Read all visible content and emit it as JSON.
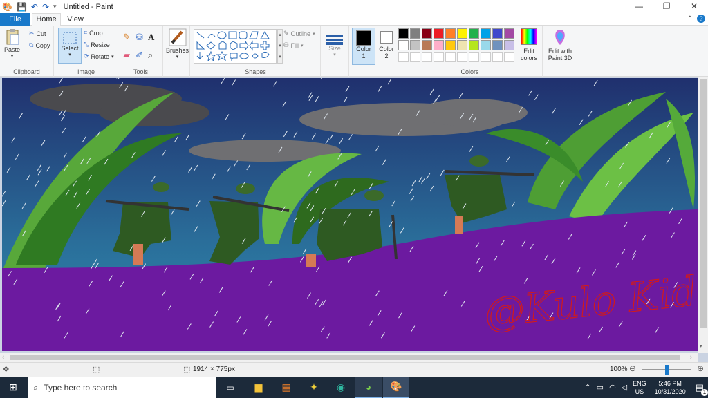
{
  "window": {
    "title": "Untitled - Paint",
    "minimize_glyph": "—",
    "maximize_glyph": "❐",
    "close_glyph": "✕"
  },
  "quick_access": {
    "save_icon": "save-icon",
    "undo_icon": "undo-icon",
    "redo_icon": "redo-icon"
  },
  "tabs": {
    "file": "File",
    "home": "Home",
    "view": "View"
  },
  "ribbon": {
    "clipboard": {
      "label": "Clipboard",
      "paste": "Paste",
      "cut": "Cut",
      "copy": "Copy"
    },
    "image": {
      "label": "Image",
      "select": "Select",
      "crop": "Crop",
      "resize": "Resize",
      "rotate": "Rotate"
    },
    "tools": {
      "label": "Tools"
    },
    "brushes": {
      "label": "Brushes"
    },
    "shapes": {
      "label": "Shapes",
      "outline": "Outline",
      "fill": "Fill"
    },
    "size": {
      "label": "Size"
    },
    "color1": {
      "label": "Color",
      "sub": "1"
    },
    "color2": {
      "label": "Color",
      "sub": "2"
    },
    "colors": {
      "label": "Colors",
      "edit_colors_line1": "Edit",
      "edit_colors_line2": "colors",
      "palette_row1": [
        "#000000",
        "#7f7f7f",
        "#880015",
        "#ed1c24",
        "#ff7f27",
        "#fff200",
        "#22b14c",
        "#00a2e8",
        "#3f48cc",
        "#a349a4"
      ],
      "palette_row2": [
        "#ffffff",
        "#c3c3c3",
        "#b97a57",
        "#ffaec9",
        "#ffc90e",
        "#efe4b0",
        "#b5e61d",
        "#99d9ea",
        "#7092be",
        "#c8bfe7"
      ]
    },
    "paint3d": {
      "line1": "Edit with",
      "line2": "Paint 3D"
    }
  },
  "canvas": {
    "signature": "@Kulo Kid"
  },
  "status": {
    "image_size": "1914 × 775px",
    "zoom": "100%"
  },
  "taskbar": {
    "search_placeholder": "Type here to search",
    "language_line1": "ENG",
    "language_line2": "US",
    "time": "5:46 PM",
    "date": "10/31/2020",
    "notification_count": "1"
  }
}
